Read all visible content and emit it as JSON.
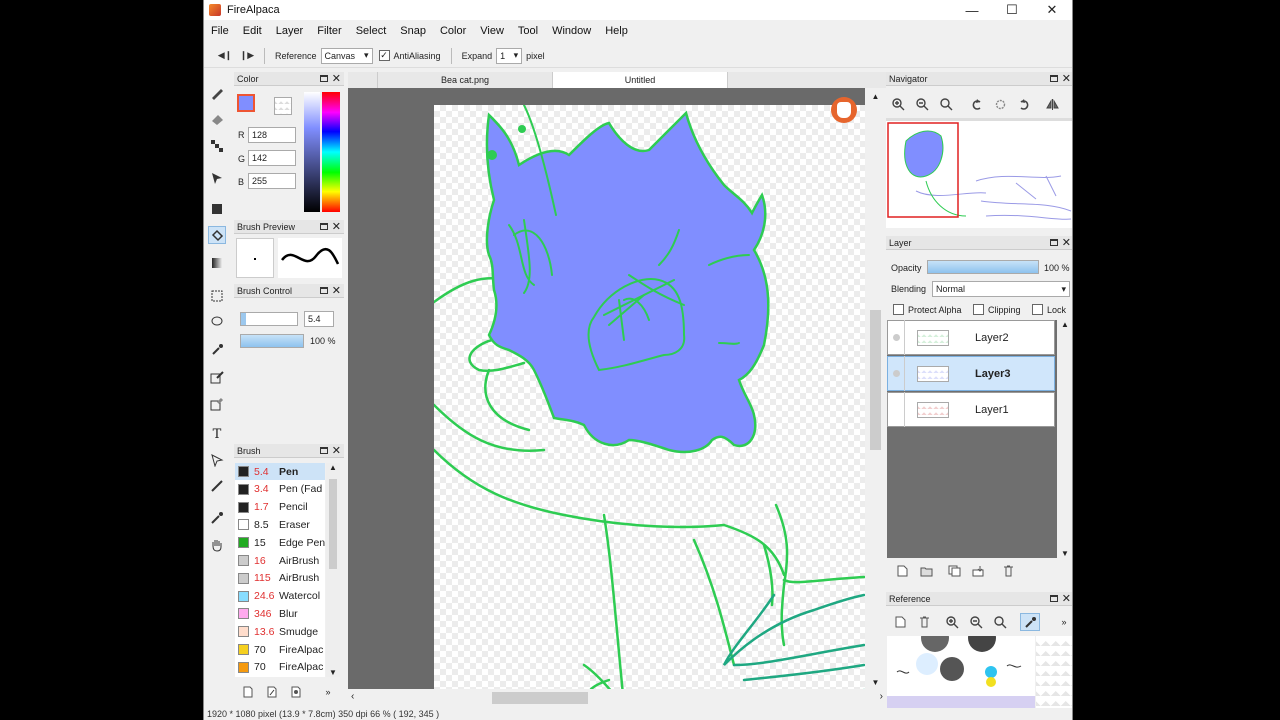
{
  "window": {
    "title": "FireAlpaca",
    "min": "—",
    "max": "☐",
    "close": "✕"
  },
  "menu": [
    "File",
    "Edit",
    "Layer",
    "Filter",
    "Select",
    "Snap",
    "Color",
    "View",
    "Tool",
    "Window",
    "Help"
  ],
  "toolbar": {
    "reference_label": "Reference",
    "reference_value": "Canvas",
    "antialiasing_label": "AntiAliasing",
    "antialiasing_checked": true,
    "expand_label": "Expand",
    "expand_value": "1",
    "unit": "pixel"
  },
  "color_panel": {
    "title": "Color",
    "r_label": "R",
    "r": "128",
    "g_label": "G",
    "g": "142",
    "b_label": "B",
    "b": "255",
    "fg_color": "#808eff"
  },
  "brush_preview": {
    "title": "Brush Preview"
  },
  "brush_control": {
    "title": "Brush Control",
    "size": "5.4",
    "opacity": "100 %",
    "opacity_level": 1.0
  },
  "brush_panel": {
    "title": "Brush",
    "items": [
      {
        "size": "5.4",
        "name": "Pen",
        "color": "#222222",
        "selected": true,
        "red": true
      },
      {
        "size": "3.4",
        "name": "Pen (Fad",
        "color": "#222222",
        "red": true
      },
      {
        "size": "1.7",
        "name": "Pencil",
        "color": "#222222",
        "red": true
      },
      {
        "size": "8.5",
        "name": "Eraser",
        "color": "#ffffff",
        "red": false
      },
      {
        "size": "15",
        "name": "Edge Pen",
        "color": "#22aa22",
        "red": false
      },
      {
        "size": "16",
        "name": "AirBrush",
        "color": "#cccccc",
        "red": true
      },
      {
        "size": "115",
        "name": "AirBrush",
        "color": "#cccccc",
        "red": true
      },
      {
        "size": "24.6",
        "name": "Watercol",
        "color": "#88ddff",
        "red": true
      },
      {
        "size": "346",
        "name": "Blur",
        "color": "#ffaaee",
        "red": true
      },
      {
        "size": "13.6",
        "name": "Smudge",
        "color": "#ffddcc",
        "red": true
      },
      {
        "size": "70",
        "name": "FireAlpac",
        "color": "#f5d020",
        "red": false
      },
      {
        "size": "70",
        "name": "FireAlpac",
        "color": "#f59a10",
        "red": false
      }
    ]
  },
  "tabs": [
    {
      "label": "Bea cat.png",
      "active": false
    },
    {
      "label": "Untitled",
      "active": true
    }
  ],
  "navigator": {
    "title": "Navigator"
  },
  "layer_panel": {
    "title": "Layer",
    "opacity_label": "Opacity",
    "opacity": "100 %",
    "opacity_level": 1.0,
    "blending_label": "Blending",
    "blending": "Normal",
    "protect_alpha": "Protect Alpha",
    "clipping": "Clipping",
    "lock": "Lock",
    "layers": [
      {
        "name": "Layer2",
        "selected": false
      },
      {
        "name": "Layer3",
        "selected": true
      },
      {
        "name": "Layer1",
        "selected": false
      }
    ]
  },
  "reference_panel": {
    "title": "Reference"
  },
  "status": "1920 * 1080 pixel  (13.9 * 7.8cm)  350 dpi  66 %  ( 192, 345 )",
  "colors": {
    "line_green": "#2ecc52",
    "fill_blue": "#808eff",
    "select_blue": "#cde3f7"
  }
}
